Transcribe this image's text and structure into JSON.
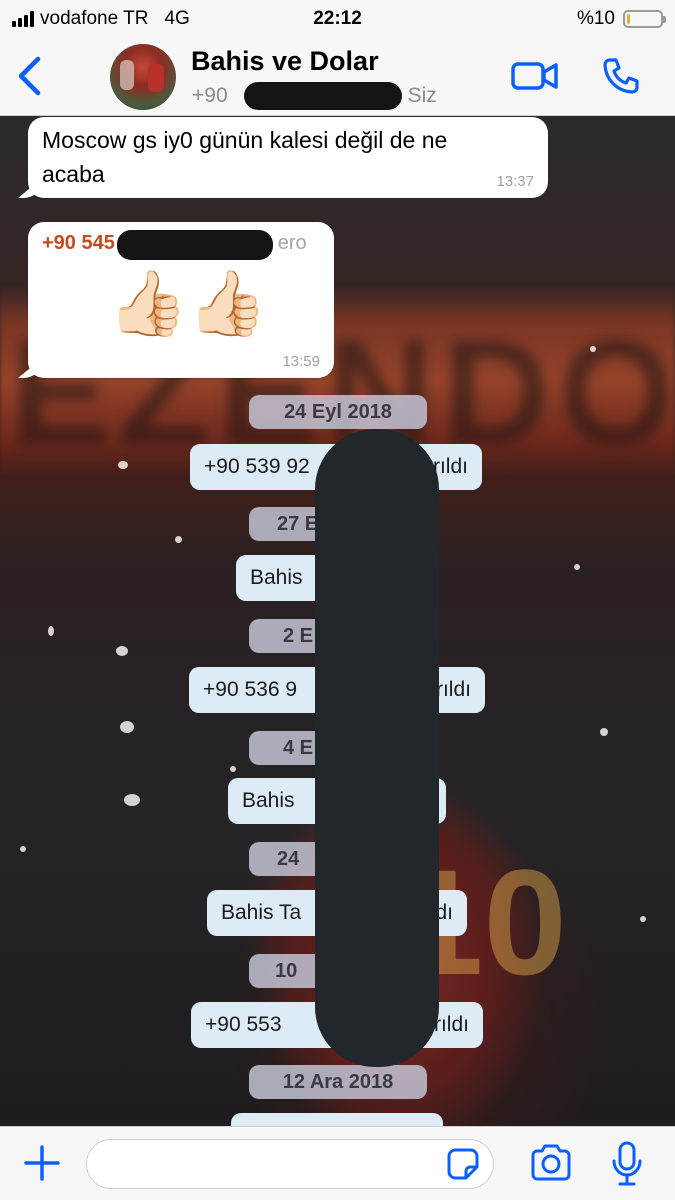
{
  "status_bar": {
    "carrier": "vodafone TR",
    "network": "4G",
    "time": "22:12",
    "battery_label": "%10",
    "battery_level": 0.1
  },
  "header": {
    "title": "Bahis ve Dolar",
    "subtitle_prefix": "+90",
    "subtitle_suffix": "Siz"
  },
  "messages": [
    {
      "text": "Moscow gs iy0 günün kalesi değil de ne acaba",
      "time": "13:37"
    },
    {
      "sender": "+90 545",
      "sender_tail": "ero",
      "emoji": "👍🏻👍🏻",
      "time": "13:59"
    }
  ],
  "events": [
    {
      "date": "24 Eyl 2018",
      "system": "+90 539 92",
      "system_tail": "yrıldı"
    },
    {
      "date": "27 E",
      "system": "Bahis",
      "system_tail": ""
    },
    {
      "date": "2 E",
      "system": "+90 536 9",
      "system_tail": "yrıldı"
    },
    {
      "date": "4 E",
      "system": "Bahis",
      "system_tail": "u"
    },
    {
      "date": "24",
      "system": "Bahis Ta",
      "system_tail": "rıldı"
    },
    {
      "date": "10",
      "system": "+90 553",
      "system_tail": "yrıldı"
    },
    {
      "date": "12 Ara 2018",
      "system": "",
      "system_tail": ""
    }
  ],
  "colors": {
    "accent": "#0a60ff",
    "sender": "#c54b1d",
    "system_bubble": "#dcebf6",
    "date_pill": "#c3c3d4"
  },
  "icons": {
    "back": "chevron-left-icon",
    "video": "video-camera-icon",
    "phone": "phone-icon",
    "add": "plus-icon",
    "sticker": "sticker-icon",
    "camera": "camera-icon",
    "mic": "microphone-icon"
  }
}
